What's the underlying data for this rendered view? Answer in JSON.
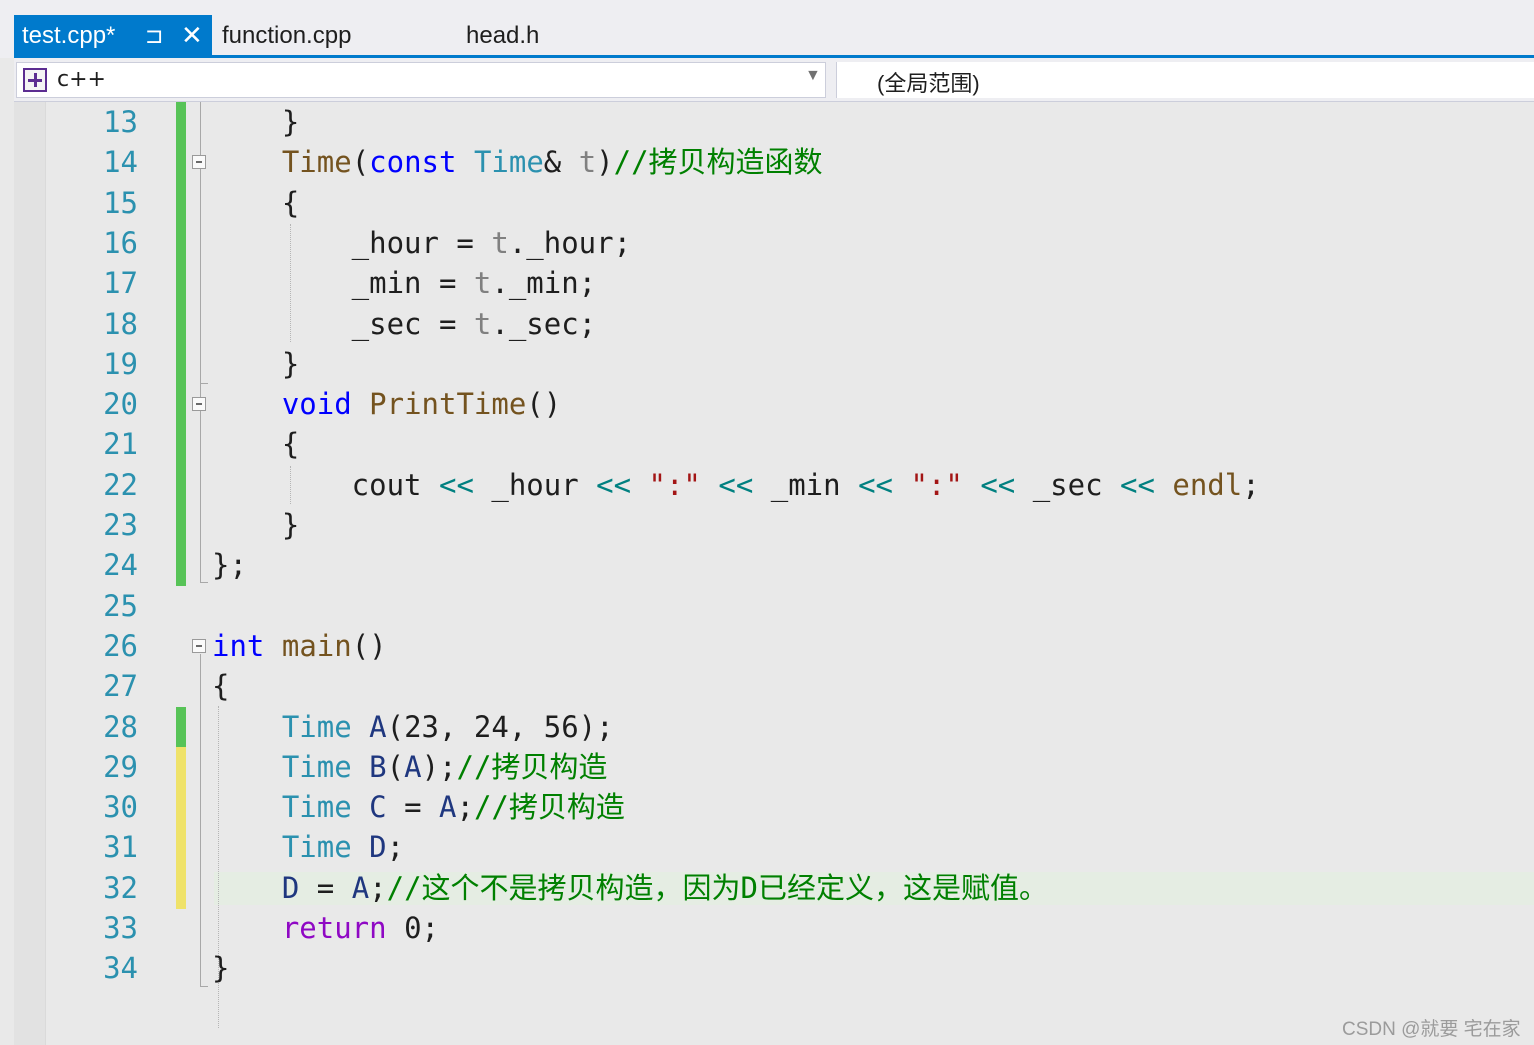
{
  "tabs": [
    {
      "label": "test.cpp*",
      "active": true
    },
    {
      "label": "function.cpp",
      "active": false
    },
    {
      "label": "head.h",
      "active": false
    }
  ],
  "tab_icons": {
    "pin": "⊐",
    "close": "✕"
  },
  "nav": {
    "project": "c++",
    "scope": "(全局范围)"
  },
  "colors": {
    "accent": "#007acc",
    "line_number": "#2b91af",
    "saved_change": "#57c357",
    "unsaved_change": "#efe26a",
    "keyword": "#0000ff",
    "type": "#2b91af",
    "function": "#74531f",
    "comment": "#008000",
    "string": "#a31515"
  },
  "editor": {
    "lines": [
      {
        "n": "13",
        "change": "saved",
        "fold": false,
        "tokens": [
          [
            "mb",
            "    }"
          ]
        ]
      },
      {
        "n": "14",
        "change": "saved",
        "fold": true,
        "tokens": [
          [
            "mb",
            "    "
          ],
          [
            "fn",
            "Time"
          ],
          [
            "mb",
            "("
          ],
          [
            "kw",
            "const"
          ],
          [
            "mb",
            " "
          ],
          [
            "ty",
            "Time"
          ],
          [
            "mb",
            "& "
          ],
          [
            "pa",
            "t"
          ],
          [
            "mb",
            ")"
          ],
          [
            "cm",
            "//拷贝构造函数"
          ]
        ]
      },
      {
        "n": "15",
        "change": "saved",
        "fold": false,
        "tokens": [
          [
            "mb",
            "    {"
          ]
        ]
      },
      {
        "n": "16",
        "change": "saved",
        "fold": false,
        "tokens": [
          [
            "mb",
            "        _hour = "
          ],
          [
            "pa",
            "t"
          ],
          [
            "mb",
            "._hour;"
          ]
        ]
      },
      {
        "n": "17",
        "change": "saved",
        "fold": false,
        "tokens": [
          [
            "mb",
            "        _min = "
          ],
          [
            "pa",
            "t"
          ],
          [
            "mb",
            "._min;"
          ]
        ]
      },
      {
        "n": "18",
        "change": "saved",
        "fold": false,
        "tokens": [
          [
            "mb",
            "        _sec = "
          ],
          [
            "pa",
            "t"
          ],
          [
            "mb",
            "._sec;"
          ]
        ]
      },
      {
        "n": "19",
        "change": "saved",
        "fold": false,
        "tokens": [
          [
            "mb",
            "    }"
          ]
        ]
      },
      {
        "n": "20",
        "change": "saved",
        "fold": true,
        "tokens": [
          [
            "mb",
            "    "
          ],
          [
            "kw",
            "void"
          ],
          [
            "mb",
            " "
          ],
          [
            "fn",
            "PrintTime"
          ],
          [
            "mb",
            "()"
          ]
        ]
      },
      {
        "n": "21",
        "change": "saved",
        "fold": false,
        "tokens": [
          [
            "mb",
            "    {"
          ]
        ]
      },
      {
        "n": "22",
        "change": "saved",
        "fold": false,
        "tokens": [
          [
            "mb",
            "        cout "
          ],
          [
            "op",
            "<<"
          ],
          [
            "mb",
            " _hour "
          ],
          [
            "op",
            "<<"
          ],
          [
            "mb",
            " "
          ],
          [
            "st",
            "\":\""
          ],
          [
            "mb",
            " "
          ],
          [
            "op",
            "<<"
          ],
          [
            "mb",
            " _min "
          ],
          [
            "op",
            "<<"
          ],
          [
            "mb",
            " "
          ],
          [
            "st",
            "\":\""
          ],
          [
            "mb",
            " "
          ],
          [
            "op",
            "<<"
          ],
          [
            "mb",
            " _sec "
          ],
          [
            "op",
            "<<"
          ],
          [
            "mb",
            " "
          ],
          [
            "fn",
            "endl"
          ],
          [
            "mb",
            ";"
          ]
        ]
      },
      {
        "n": "23",
        "change": "saved",
        "fold": false,
        "tokens": [
          [
            "mb",
            "    }"
          ]
        ]
      },
      {
        "n": "24",
        "change": "saved",
        "fold": false,
        "tokens": [
          [
            "mb",
            "};"
          ]
        ]
      },
      {
        "n": "25",
        "change": "none",
        "fold": false,
        "tokens": []
      },
      {
        "n": "26",
        "change": "none",
        "fold": true,
        "tokens": [
          [
            "kw",
            "int"
          ],
          [
            "mb",
            " "
          ],
          [
            "fn",
            "main"
          ],
          [
            "mb",
            "()"
          ]
        ]
      },
      {
        "n": "27",
        "change": "none",
        "fold": false,
        "tokens": [
          [
            "mb",
            "{"
          ]
        ]
      },
      {
        "n": "28",
        "change": "saved",
        "fold": false,
        "tokens": [
          [
            "mb",
            "    "
          ],
          [
            "ty",
            "Time"
          ],
          [
            "mb",
            " "
          ],
          [
            "va",
            "A"
          ],
          [
            "mb",
            "(23, 24, 56);"
          ]
        ]
      },
      {
        "n": "29",
        "change": "unsaved",
        "fold": false,
        "tokens": [
          [
            "mb",
            "    "
          ],
          [
            "ty",
            "Time"
          ],
          [
            "mb",
            " "
          ],
          [
            "va",
            "B"
          ],
          [
            "mb",
            "("
          ],
          [
            "va",
            "A"
          ],
          [
            "mb",
            ");"
          ],
          [
            "cm",
            "//拷贝构造"
          ]
        ]
      },
      {
        "n": "30",
        "change": "unsaved",
        "fold": false,
        "tokens": [
          [
            "mb",
            "    "
          ],
          [
            "ty",
            "Time"
          ],
          [
            "mb",
            " "
          ],
          [
            "va",
            "C"
          ],
          [
            "mb",
            " = "
          ],
          [
            "va",
            "A"
          ],
          [
            "mb",
            ";"
          ],
          [
            "cm",
            "//拷贝构造"
          ]
        ]
      },
      {
        "n": "31",
        "change": "unsaved",
        "fold": false,
        "tokens": [
          [
            "mb",
            "    "
          ],
          [
            "ty",
            "Time"
          ],
          [
            "mb",
            " "
          ],
          [
            "va",
            "D"
          ],
          [
            "mb",
            ";"
          ]
        ]
      },
      {
        "n": "32",
        "change": "unsaved",
        "fold": false,
        "tokens": [
          [
            "mb",
            "    "
          ],
          [
            "va",
            "D"
          ],
          [
            "mb",
            " = "
          ],
          [
            "va",
            "A"
          ],
          [
            "mb",
            ";"
          ],
          [
            "cm",
            "//这个不是拷贝构造，因为D已经定义，这是赋值。"
          ]
        ]
      },
      {
        "n": "33",
        "change": "none",
        "fold": false,
        "tokens": [
          [
            "mb",
            "    "
          ],
          [
            "ret",
            "return"
          ],
          [
            "mb",
            " 0;"
          ]
        ]
      },
      {
        "n": "34",
        "change": "none",
        "fold": false,
        "tokens": [
          [
            "mb",
            "}"
          ]
        ]
      }
    ]
  },
  "watermark": "CSDN @就要 宅在家"
}
